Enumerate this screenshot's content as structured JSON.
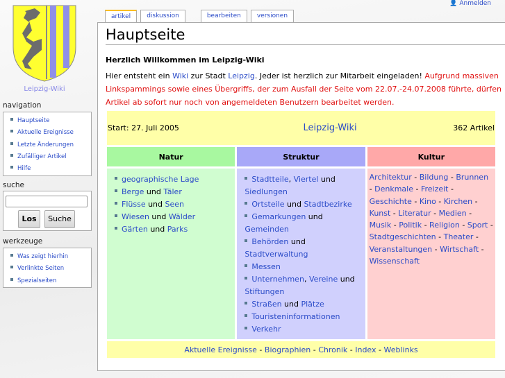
{
  "logo": {
    "caption": "Leipzig-Wiki"
  },
  "personal": {
    "login": "Anmelden"
  },
  "tabs": [
    "artikel",
    "diskussion",
    "bearbeiten",
    "versionen"
  ],
  "sidebar": {
    "navigation": {
      "title": "navigation",
      "items": [
        "Hauptseite",
        "Aktuelle Ereignisse",
        "Letzte Änderungen",
        "Zufälliger Artikel",
        "Hilfe"
      ]
    },
    "search": {
      "title": "suche",
      "go": "Los",
      "search": "Suche",
      "value": ""
    },
    "tools": {
      "title": "werkzeuge",
      "items": [
        "Was zeigt hierhin",
        "Verlinkte Seiten",
        "Spezialseiten"
      ]
    }
  },
  "page": {
    "title": "Hauptseite",
    "welcome": "Herzlich Willkommen im Leipzig-Wiki",
    "intro": [
      {
        "t": "Hier entsteht ein "
      },
      {
        "t": "Wiki",
        "link": true
      },
      {
        "t": " zur Stadt "
      },
      {
        "t": "Leipzig",
        "link": true
      },
      {
        "t": ". Jeder ist herzlich zur Mitarbeit eingeladen! "
      },
      {
        "t": "Aufgrund massiven Linkspammings sowie eines Übergriffs, der zum Ausfall der Seite vom 22.07.-24.07.2008 führte, dürfen Artikel ab sofort nur noch von angemeldeten Benutzern bearbeitet werden.",
        "red": true
      }
    ],
    "start": "Start: 27. Juli 2005",
    "wikiname": "Leipzig-Wiki",
    "count": "362 Artikel",
    "columns": [
      {
        "title": "Natur",
        "color": "#a8f8a0",
        "bg": "#d0fdd0",
        "items": [
          [
            {
              "t": "geographische Lage",
              "link": true
            }
          ],
          [
            {
              "t": "Berge",
              "link": true
            },
            {
              "t": " und "
            },
            {
              "t": "Täler",
              "link": true
            }
          ],
          [
            {
              "t": "Flüsse",
              "link": true
            },
            {
              "t": " und "
            },
            {
              "t": "Seen",
              "link": true
            }
          ],
          [
            {
              "t": "Wiesen",
              "link": true
            },
            {
              "t": " und "
            },
            {
              "t": "Wälder",
              "link": true
            }
          ],
          [
            {
              "t": "Gärten",
              "link": true
            },
            {
              "t": " und "
            },
            {
              "t": "Parks",
              "link": true
            }
          ]
        ]
      },
      {
        "title": "Struktur",
        "color": "#a8a8f8",
        "bg": "#d0d0fd",
        "items": [
          [
            {
              "t": "Stadtteile",
              "link": true
            },
            {
              "t": ", "
            },
            {
              "t": "Viertel",
              "link": true
            },
            {
              "t": " und "
            },
            {
              "t": "Siedlungen",
              "link": true
            }
          ],
          [
            {
              "t": "Ortsteile",
              "link": true
            },
            {
              "t": " und "
            },
            {
              "t": "Stadtbezirke",
              "link": true
            }
          ],
          [
            {
              "t": "Gemarkungen",
              "link": true
            },
            {
              "t": " und "
            },
            {
              "t": "Gemeinden",
              "link": true
            }
          ],
          [
            {
              "t": "Behörden",
              "link": true
            },
            {
              "t": " und "
            },
            {
              "t": "Stadtverwaltung",
              "link": true
            }
          ],
          [
            {
              "t": "Messen",
              "link": true
            }
          ],
          [
            {
              "t": "Unternehmen",
              "link": true
            },
            {
              "t": ", "
            },
            {
              "t": "Vereine",
              "link": true
            },
            {
              "t": " und "
            },
            {
              "t": "Stiftungen",
              "link": true
            }
          ],
          [
            {
              "t": "Straßen",
              "link": true
            },
            {
              "t": " und "
            },
            {
              "t": "Plätze",
              "link": true
            }
          ],
          [
            {
              "t": "Touristeninformationen",
              "link": true
            }
          ],
          [
            {
              "t": "Verkehr",
              "link": true
            }
          ]
        ]
      },
      {
        "title": "Kultur",
        "color": "#ffa8a8",
        "bg": "#ffd0d0",
        "links": [
          "Architektur",
          "Bildung",
          "Brunnen",
          "Denkmale",
          "Freizeit",
          "Geschichte",
          "Kino",
          "Kirchen",
          "Kunst",
          "Literatur",
          "Medien",
          "Musik",
          "Politik",
          "Religion",
          "Sport",
          "Stadtgeschichten",
          "Theater",
          "Veranstaltungen",
          "Wirtschaft",
          "Wissenschaft"
        ]
      }
    ],
    "footer_links": [
      "Aktuelle Ereignisse",
      "Biographien",
      "Chronik",
      "Index",
      "Weblinks"
    ]
  }
}
